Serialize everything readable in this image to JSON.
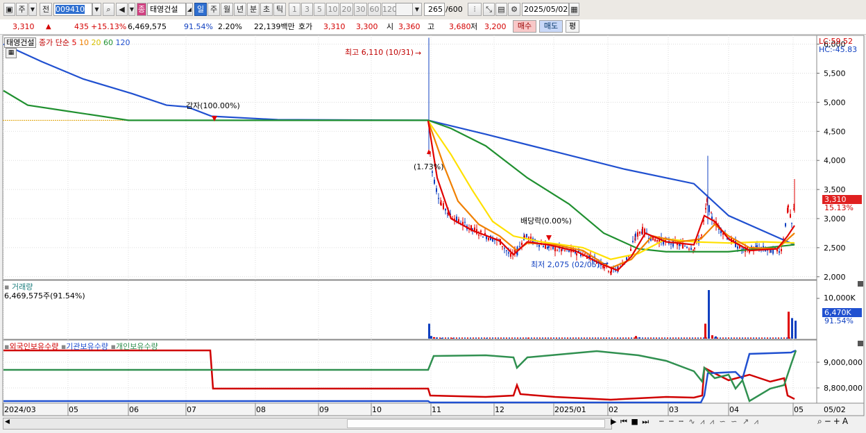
{
  "toolbar": {
    "market": "주",
    "prev_label": "전",
    "code": "009410",
    "stock_badge": "종",
    "stock_name": "태영건설",
    "periods": [
      "일",
      "주",
      "월",
      "년",
      "분",
      "초",
      "틱"
    ],
    "minutes": [
      "1",
      "3",
      "5",
      "10",
      "20",
      "30",
      "60",
      "120"
    ],
    "count": "265",
    "count_max": "/600",
    "date": "2025/05/02"
  },
  "quote": {
    "price": "3,310",
    "up_arrow": "▲",
    "change": "435",
    "change_pct": "+15.13%",
    "volume": "6,469,575",
    "volume_ratio": "91.54%",
    "turnover": "2.20%",
    "amount": "22,139백만",
    "bid_label": "호가",
    "bid": "3,310",
    "ask": "3,300",
    "open_label": "시",
    "open": "3,360",
    "high_label": "고",
    "high": "3,680",
    "low_label": "저",
    "low": "3,200",
    "buy_label": "매수",
    "sell_label": "매도",
    "eval_label": "평"
  },
  "price_pane": {
    "legend_name": "태영건설",
    "legend_ma": "종가 단순",
    "ma_periods": [
      "5",
      "10",
      "20",
      "60",
      "120"
    ],
    "ma_colors": [
      "#e00000",
      "#f08000",
      "#ffe000",
      "#209030",
      "#2050d0"
    ],
    "lc": "LC:59.52",
    "hc": "HC:-45.83",
    "yticks": [
      "6,000",
      "5,500",
      "5,000",
      "4,500",
      "4,000",
      "3,500",
      "3,000",
      "2,500",
      "2,000"
    ],
    "annotations": {
      "high": "최고 6,110 (10/31)",
      "low": "최저 2,075 (02/05)",
      "reduction": "감자(100.00%)",
      "dividend": "배당락(0.00%)",
      "pct": "(1.73%)"
    },
    "current_price": "3,310",
    "current_pct": "15.13%"
  },
  "volume_pane": {
    "title": "거래량",
    "value": "6,469,575주(91.54%)",
    "ytick": "10,000K",
    "current": "6,470K",
    "current_pct": "91.54%"
  },
  "holding_pane": {
    "legend": [
      "외국인보유수량",
      "기관보유수량",
      "개인보유수량"
    ],
    "colors": [
      "#d00000",
      "#2050d0",
      "#309050"
    ],
    "yticks": [
      "9,000,000",
      "8,800,000"
    ]
  },
  "xaxis": {
    "labels": [
      "2024/03",
      "05",
      "06",
      "07",
      "08",
      "09",
      "10",
      "11",
      "12",
      "2025/01",
      "02",
      "03",
      "04",
      "05"
    ],
    "end_label": "05/02"
  },
  "chart_data": {
    "type": "candlestick",
    "title": "태영건설",
    "ylim": [
      1950,
      6150
    ],
    "series": [
      {
        "name": "종가 단순 120",
        "x": [
          "2024/03",
          "2024/05",
          "2024/07",
          "2024/10/30",
          "2024/12",
          "2025/02",
          "2025/03",
          "2025/05/02"
        ],
        "values": [
          6000,
          5300,
          4800,
          4680,
          4100,
          3450,
          3000,
          2550
        ]
      },
      {
        "name": "종가 단순 60",
        "x": [
          "2024/03",
          "2024/04",
          "2024/06",
          "2024/10/30",
          "2024/12",
          "2025/01",
          "2025/02",
          "2025/04",
          "2025/05/02"
        ],
        "values": [
          5200,
          4880,
          4690,
          4680,
          3900,
          3000,
          2450,
          2430,
          2550
        ]
      },
      {
        "name": "종가 단순 5",
        "x": [
          "2024/10/30",
          "2024/11/05",
          "2024/11/20",
          "2024/12/15",
          "2025/01/15",
          "2025/02/05",
          "2025/03/25",
          "2025/05/02"
        ],
        "values": [
          4680,
          3600,
          2850,
          2450,
          2420,
          2100,
          2900,
          2880
        ]
      }
    ],
    "candles": {
      "high": 6110,
      "high_date": "10/31",
      "low": 2075,
      "low_date": "02/05",
      "last": 3310
    }
  }
}
